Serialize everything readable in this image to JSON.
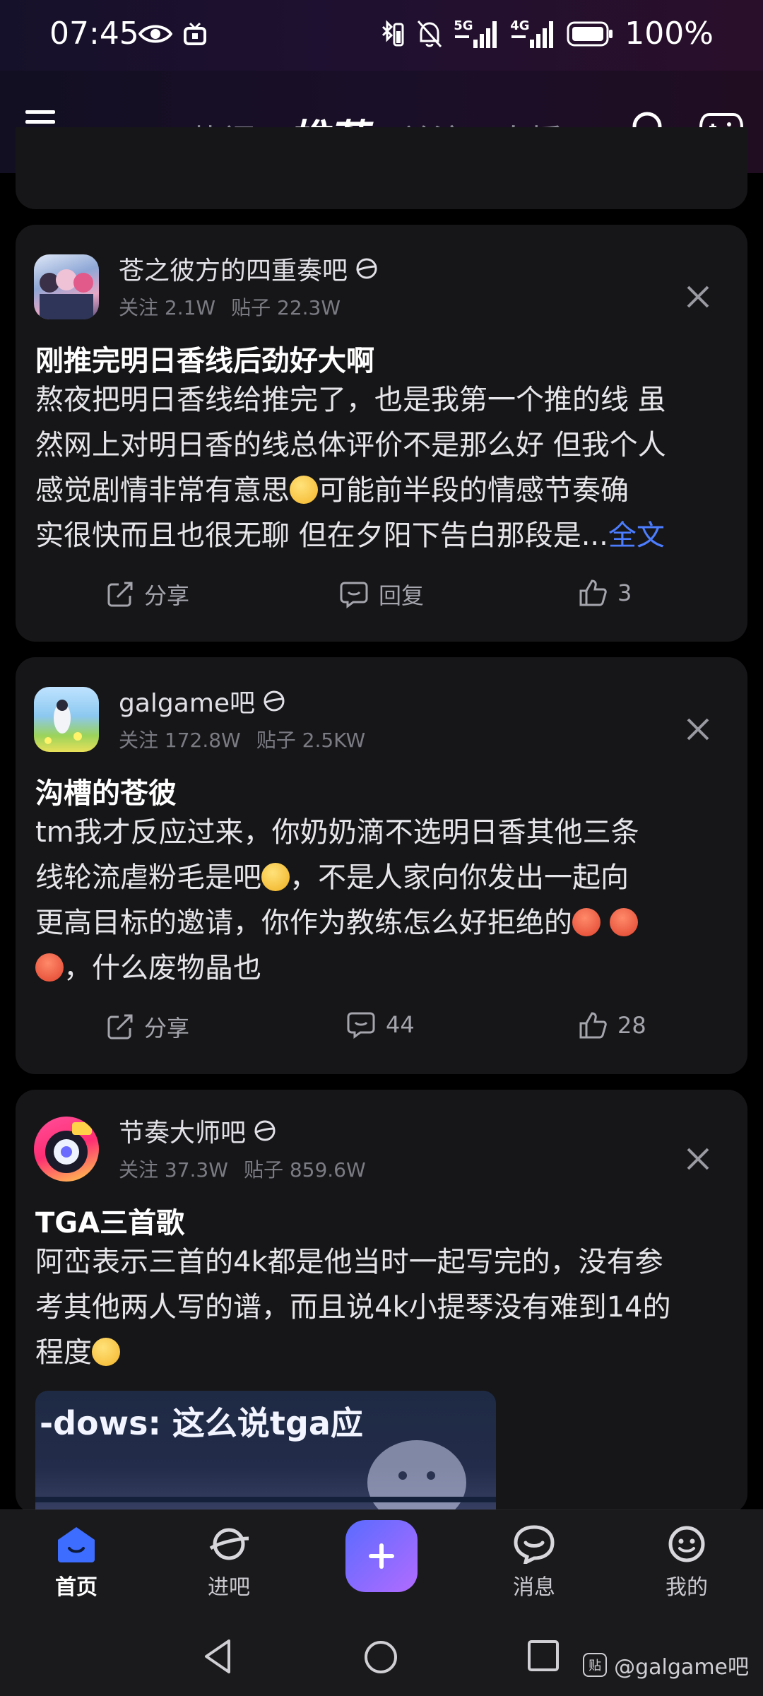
{
  "status_bar": {
    "time": "07:45",
    "battery": "100%",
    "network_5g": "5G",
    "network_4g": "4G"
  },
  "top_nav": {
    "tabs": [
      "热门",
      "推荐",
      "关注",
      "直播"
    ],
    "active_tab": "推荐"
  },
  "posts": [
    {
      "forum": "苍之彼方的四重奏吧",
      "followers": "关注 2.1W",
      "post_count": "贴子 22.3W",
      "title": "刚推完明日香线后劲好大啊",
      "body_lines": [
        "熬夜把明日香线给推完了，也是我第一个推的线 虽",
        "然网上对明日香的线总体评价不是那么好 但我个人",
        "感觉剧情非常有意思",
        "可能前半段的情感节奏确",
        "实很快而且也很无聊 但在夕阳下告白那段是..."
      ],
      "more_label": "全文",
      "share_label": "分享",
      "reply_label": "回复",
      "likes": "3"
    },
    {
      "forum": "galgame吧",
      "followers": "关注 172.8W",
      "post_count": "贴子 2.5KW",
      "title": "沟槽的苍彼",
      "body_lines": [
        "tm我才反应过来，你奶奶滴不选明日香其他三条",
        "线轮流虐粉毛是吧",
        "，不是人家向你发出一起向",
        "更高目标的邀请，你作为教练怎么好拒绝的",
        "，什么废物晶也"
      ],
      "share_label": "分享",
      "replies": "44",
      "likes": "28"
    },
    {
      "forum": "节奏大师吧",
      "followers": "关注 37.3W",
      "post_count": "贴子 859.6W",
      "title": "TGA三首歌",
      "body_lines": [
        "阿峦表示三首的4k都是他当时一起写完的，没有参",
        "考其他两人写的谱，而且说4k小提琴没有难到14的",
        "程度"
      ],
      "image_caption": "-dows: 这么说tga应"
    }
  ],
  "bottom_nav": {
    "home": "首页",
    "forums": "进吧",
    "messages": "消息",
    "mine": "我的"
  },
  "watermark": "@galgame吧",
  "watermark_logo": "贴",
  "colors": {
    "accent": "#4c7dff",
    "card_bg": "#161618",
    "post_button_start": "#5a6bff",
    "post_button_end": "#b26bff"
  }
}
